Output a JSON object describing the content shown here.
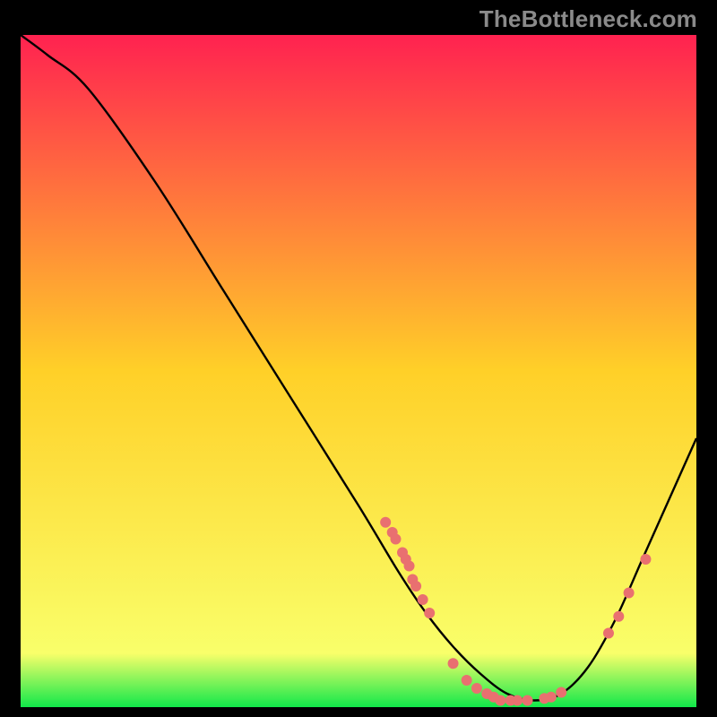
{
  "watermark": "TheBottleneck.com",
  "chart_data": {
    "type": "line",
    "title": "",
    "xlabel": "",
    "ylabel": "",
    "xlim": [
      0,
      100
    ],
    "ylim": [
      0,
      100
    ],
    "grid": false,
    "legend": false,
    "gradient_stops": [
      {
        "offset": 0,
        "color": "#ff2250"
      },
      {
        "offset": 50,
        "color": "#ffd028"
      },
      {
        "offset": 92,
        "color": "#f9ff6a"
      },
      {
        "offset": 100,
        "color": "#11e84a"
      }
    ],
    "series": [
      {
        "name": "bottleneck-curve",
        "x": [
          0,
          4,
          10,
          20,
          30,
          40,
          50,
          56,
          60,
          64,
          68,
          72,
          76,
          80,
          84,
          88,
          92,
          96,
          100
        ],
        "y": [
          100,
          97,
          92,
          78,
          62,
          46,
          30,
          20,
          14,
          9,
          5,
          2,
          1,
          2,
          6,
          13,
          22,
          31,
          40
        ]
      }
    ],
    "scatter": {
      "name": "data-points",
      "color": "#e97070",
      "radius": 6,
      "points": [
        {
          "x": 54,
          "y": 27.5
        },
        {
          "x": 55,
          "y": 26
        },
        {
          "x": 55.5,
          "y": 25
        },
        {
          "x": 56.5,
          "y": 23
        },
        {
          "x": 57,
          "y": 22
        },
        {
          "x": 57.5,
          "y": 21
        },
        {
          "x": 58,
          "y": 19
        },
        {
          "x": 58.5,
          "y": 18
        },
        {
          "x": 59.5,
          "y": 16
        },
        {
          "x": 60.5,
          "y": 14
        },
        {
          "x": 64,
          "y": 6.5
        },
        {
          "x": 66,
          "y": 4
        },
        {
          "x": 67.5,
          "y": 2.8
        },
        {
          "x": 69,
          "y": 2
        },
        {
          "x": 70,
          "y": 1.5
        },
        {
          "x": 71,
          "y": 1
        },
        {
          "x": 72.5,
          "y": 1
        },
        {
          "x": 73.5,
          "y": 1
        },
        {
          "x": 75,
          "y": 1
        },
        {
          "x": 77.5,
          "y": 1.3
        },
        {
          "x": 78.5,
          "y": 1.5
        },
        {
          "x": 80,
          "y": 2.2
        },
        {
          "x": 87,
          "y": 11
        },
        {
          "x": 88.5,
          "y": 13.5
        },
        {
          "x": 90,
          "y": 17
        },
        {
          "x": 92.5,
          "y": 22
        }
      ]
    }
  }
}
